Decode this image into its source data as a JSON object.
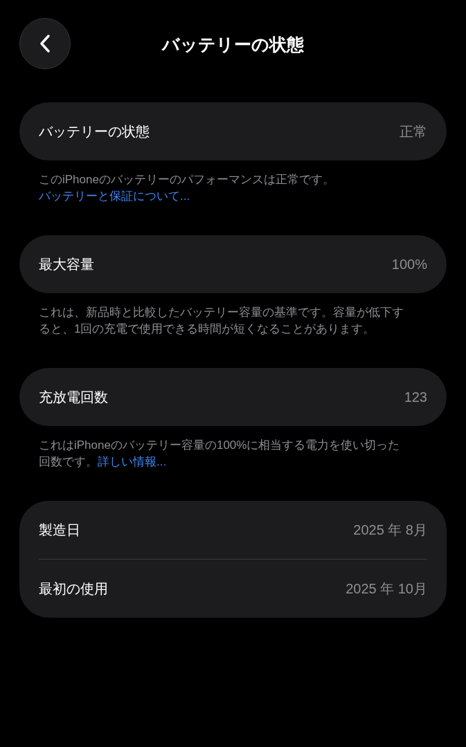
{
  "title": "バッテリーの状態",
  "sections": [
    {
      "rows": [
        {
          "label": "バッテリーの状態",
          "value": "正常"
        }
      ],
      "footer": {
        "text": "このiPhoneのバッテリーのパフォーマンスは正常です。",
        "link": "バッテリーと保証について..."
      }
    },
    {
      "rows": [
        {
          "label": "最大容量",
          "value": "100%"
        }
      ],
      "footer": {
        "text": "これは、新品時と比較したバッテリー容量の基準です。容量が低下すると、1回の充電で使用できる時間が短くなることがあります。"
      }
    },
    {
      "rows": [
        {
          "label": "充放電回数",
          "value": "123"
        }
      ],
      "footer": {
        "text": "これはiPhoneのバッテリー容量の100%に相当する電力を使い切った回数です。",
        "link": "詳しい情報..."
      }
    },
    {
      "rows": [
        {
          "label": "製造日",
          "value": "2025 年 8月"
        },
        {
          "label": "最初の使用",
          "value": "2025 年 10月"
        }
      ]
    }
  ]
}
